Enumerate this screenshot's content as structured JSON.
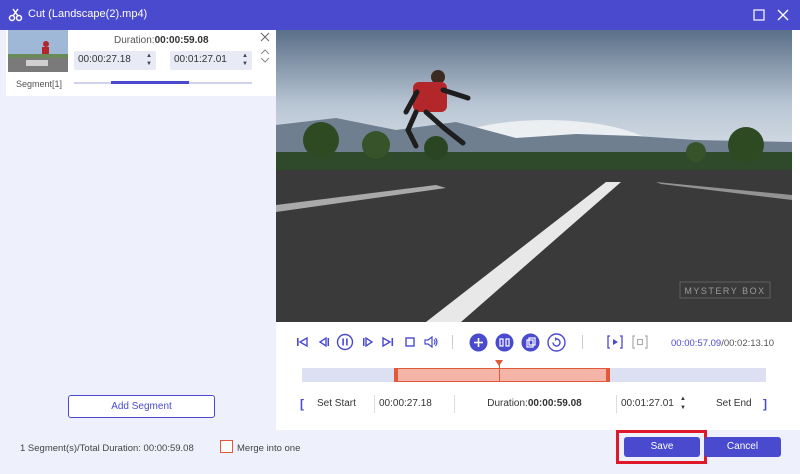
{
  "window": {
    "title": "Cut (Landscape(2).mp4)"
  },
  "segment_card": {
    "duration_label": "Duration:",
    "duration_value": "00:00:59.08",
    "start_time": "00:00:27.18",
    "end_time": "00:01:27.01",
    "label": "Segment[1]",
    "progress_fraction": 0.44
  },
  "add_segment_label": "Add Segment",
  "player": {
    "current_time": "00:00:57.09",
    "total_time": "/00:02:13.10",
    "watermark": "MYSTERY BOX"
  },
  "timeline": {
    "selection_start_fraction": 0.203,
    "selection_end_fraction": 0.66,
    "playhead_fraction": 0.425
  },
  "range_row": {
    "set_start_label": "Set Start",
    "start_time": "00:00:27.18",
    "duration_label": "Duration:",
    "duration_value": "00:00:59.08",
    "end_time": "00:01:27.01",
    "set_end_label": "Set End",
    "bracket_left": "[",
    "bracket_right": "]"
  },
  "footer": {
    "summary": "1 Segment(s)/Total Duration: 00:00:59.08",
    "merge_label": "Merge into one",
    "save_label": "Save",
    "cancel_label": "Cancel"
  },
  "colors": {
    "accent": "#4a4acf",
    "highlight": "#e0192a",
    "selection": "#e05a3a"
  }
}
